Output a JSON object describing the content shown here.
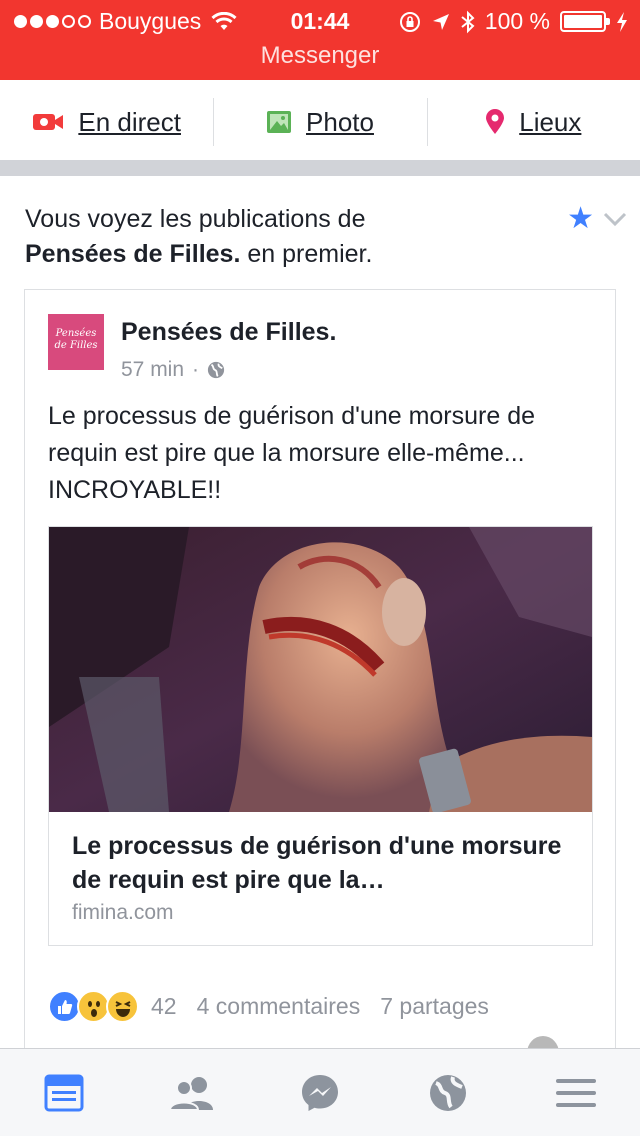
{
  "status_bar": {
    "carrier": "Bouygues",
    "signal_bars_filled": 3,
    "signal_bars_total": 5,
    "time": "01:44",
    "battery_percent": "100 %",
    "battery_level": 1.0,
    "return_banner": "Messenger"
  },
  "composer": {
    "live_label": "En direct",
    "photo_label": "Photo",
    "places_label": "Lieux",
    "colors": {
      "live": "#f23b3b",
      "photo": "#5bb256",
      "places": "#e5296e"
    }
  },
  "see_first": {
    "prefix": "Vous voyez les publications de",
    "page": "Pensées de Filles.",
    "suffix": " en premier."
  },
  "post": {
    "page_name": "Pensées de Filles.",
    "avatar_text": "Pensées de Filles",
    "time": "57 min",
    "meta_separator": "·",
    "privacy_icon": "globe-icon",
    "text": "Le processus de guérison d'une morsure de requin est pire que la morsure elle-même... INCROYABLE!!",
    "link": {
      "title": "Le processus de guérison d'une morsure de requin est pire que la…",
      "domain": "fimina.com",
      "image_subject": "photo of a bitten foot"
    },
    "reactions": {
      "types": [
        "like",
        "wow",
        "haha"
      ],
      "count": "42",
      "comments": "4 commentaires",
      "shares": "7 partages"
    }
  },
  "tab_bar": {
    "items": [
      {
        "name": "news-feed",
        "icon": "news-feed-icon",
        "active": true
      },
      {
        "name": "friend-requests",
        "icon": "friends-icon",
        "active": false
      },
      {
        "name": "messenger",
        "icon": "messenger-icon",
        "active": false
      },
      {
        "name": "notifications",
        "icon": "globe-icon",
        "active": false
      },
      {
        "name": "more",
        "icon": "menu-icon",
        "active": false
      }
    ],
    "colors": {
      "active": "#4080ff",
      "inactive": "#8d949e"
    }
  },
  "colors": {
    "status_bar": "#f2362f",
    "brand_blue": "#4080ff",
    "text": "#1d2129",
    "secondary_text": "#90949c"
  }
}
